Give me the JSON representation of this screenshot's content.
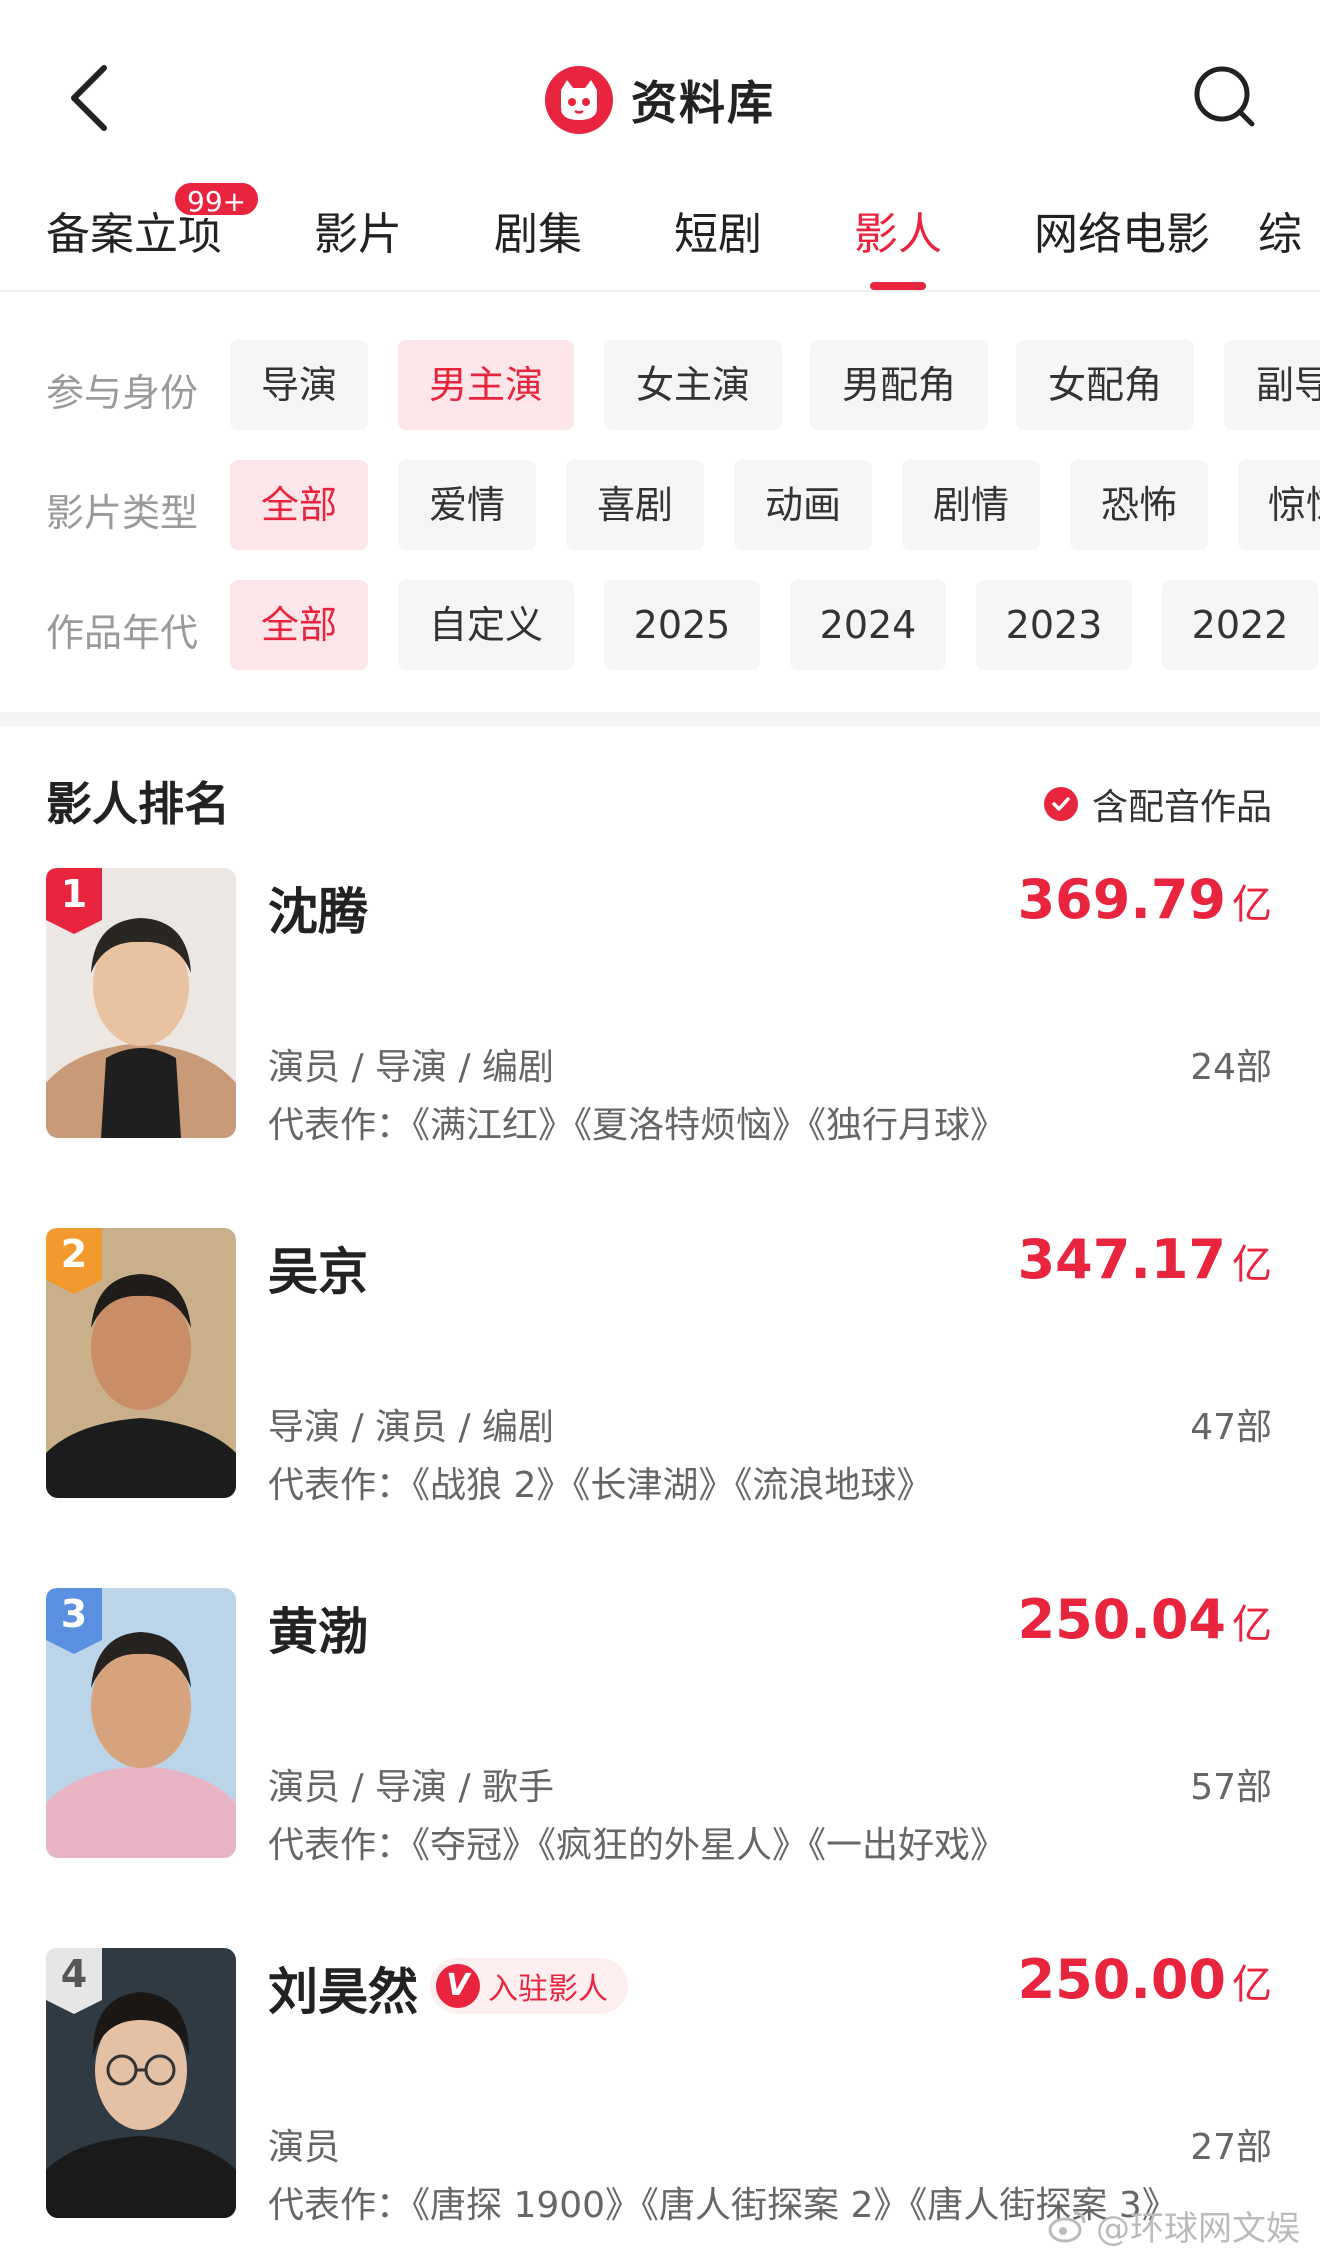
{
  "header": {
    "title": "资料库"
  },
  "tabs": [
    {
      "label": "备案立项",
      "badge": "99+"
    },
    {
      "label": "影片"
    },
    {
      "label": "剧集"
    },
    {
      "label": "短剧"
    },
    {
      "label": "影人",
      "active": true
    },
    {
      "label": "网络电影"
    },
    {
      "label": "综"
    }
  ],
  "filters": {
    "identity": {
      "label": "参与身份",
      "options": [
        "导演",
        "男主演",
        "女主演",
        "男配角",
        "女配角",
        "副导"
      ],
      "selected": "男主演"
    },
    "genre": {
      "label": "影片类型",
      "options": [
        "全部",
        "爱情",
        "喜剧",
        "动画",
        "剧情",
        "恐怖",
        "惊悚"
      ],
      "selected": "全部"
    },
    "era": {
      "label": "作品年代",
      "options": [
        "全部",
        "自定义",
        "2025",
        "2024",
        "2023",
        "2022"
      ],
      "selected": "全部"
    }
  },
  "ranking": {
    "title": "影人排名",
    "dub_toggle": "含配音作品",
    "people": [
      {
        "rank": "1",
        "name": "沈腾",
        "boxoffice": "369.79",
        "unit": "亿",
        "roles": "演员 / 导演 / 编剧",
        "count": "24部",
        "works": "代表作：《满江红》《夏洛特烦恼》《独行月球》"
      },
      {
        "rank": "2",
        "name": "吴京",
        "boxoffice": "347.17",
        "unit": "亿",
        "roles": "导演 / 演员 / 编剧",
        "count": "47部",
        "works": "代表作：《战狼 2》《长津湖》《流浪地球》"
      },
      {
        "rank": "3",
        "name": "黄渤",
        "boxoffice": "250.04",
        "unit": "亿",
        "roles": "演员 / 导演 / 歌手",
        "count": "57部",
        "works": "代表作：《夺冠》《疯狂的外星人》《一出好戏》"
      },
      {
        "rank": "4",
        "name": "刘昊然",
        "verified": "入驻影人",
        "verified_mark": "V",
        "boxoffice": "250.00",
        "unit": "亿",
        "roles": "演员",
        "count": "27部",
        "works": "代表作：《唐探 1900》《唐人街探案 2》《唐人街探案 3》"
      }
    ]
  },
  "watermark": "@环球网文娱",
  "colors": {
    "accent": "#e8243f",
    "rank1": "#e8243f",
    "rank2": "#f29a2e",
    "rank3": "#5b8fe0",
    "rank4": "#9a9a9a"
  }
}
